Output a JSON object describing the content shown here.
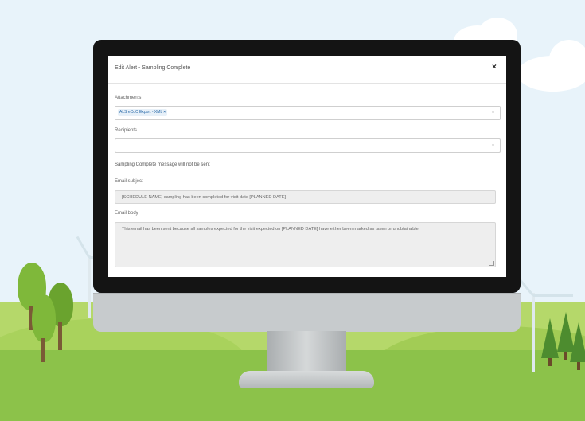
{
  "dialog": {
    "title": "Edit Alert - Sampling Complete",
    "close_label": "×"
  },
  "attachments": {
    "label": "Attachments",
    "selected_tag": "ALS eCoC Export - XML",
    "tag_remove": "×"
  },
  "recipients": {
    "label": "Recipients",
    "value": ""
  },
  "status_message": "Sampling Complete message will not be sent",
  "email_subject": {
    "label": "Email subject",
    "value": "[SCHEDULE NAME] sampling has been completed for visit date [PLANNED DATE]"
  },
  "email_body": {
    "label": "Email body",
    "value": "This email has been sent because all samples expected for the visit expected on [PLANNED DATE] have either been marked as taken or unobtainable."
  },
  "icons": {
    "dropdown": "chevron-down-icon",
    "close": "close-icon"
  },
  "colors": {
    "sky": "#e8f3fa",
    "grass": "#8cc24a",
    "tag_text": "#2a6aa8",
    "monitor_bezel": "#141414"
  }
}
